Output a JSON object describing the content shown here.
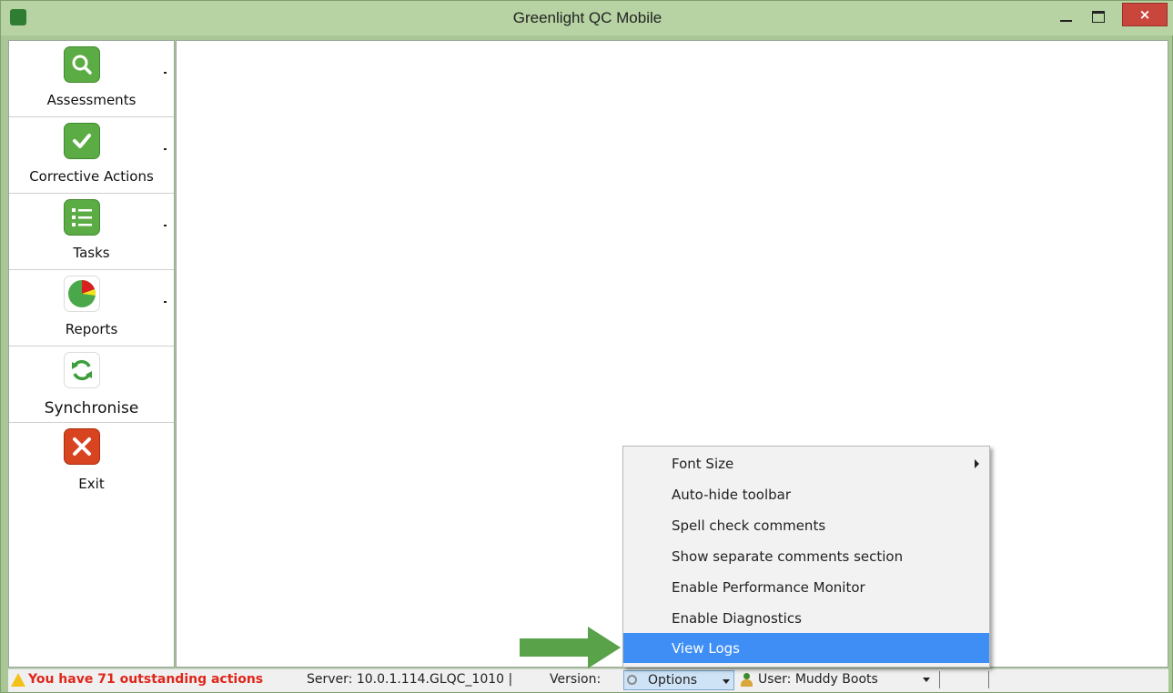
{
  "window": {
    "title": "Greenlight QC Mobile",
    "close_glyph": "×",
    "colors": {
      "frame": "#a9c796",
      "close": "#c9463d"
    }
  },
  "sidebar": {
    "items": [
      {
        "label": "Assessments",
        "icon": "search-icon"
      },
      {
        "label": "Corrective Actions",
        "icon": "checkmark-icon"
      },
      {
        "label": "Tasks",
        "icon": "list-icon"
      },
      {
        "label": "Reports",
        "icon": "pie-chart-icon"
      },
      {
        "label": "Synchronise",
        "icon": "sync-icon"
      },
      {
        "label": "Exit",
        "icon": "close-icon"
      }
    ]
  },
  "options_menu": {
    "items": [
      {
        "label": "Font Size",
        "has_submenu": true
      },
      {
        "label": "Auto-hide toolbar"
      },
      {
        "label": "Spell check comments"
      },
      {
        "label": "Show separate comments section"
      },
      {
        "label": "Enable Performance Monitor"
      },
      {
        "label": "Enable Diagnostics"
      },
      {
        "label": "View Logs",
        "highlighted": true
      }
    ],
    "highlight_color": "#3e8ef6"
  },
  "statusbar": {
    "warning": "You have 71 outstanding actions",
    "server": "Server: 10.0.1.114.GLQC_1010  |",
    "version": "Version:",
    "options_label": "Options",
    "user": "User: Muddy Boots",
    "warning_color": "#e0261a"
  },
  "annotation": {
    "arrow_color": "#5aa24a",
    "icon": "arrow-right-icon"
  }
}
